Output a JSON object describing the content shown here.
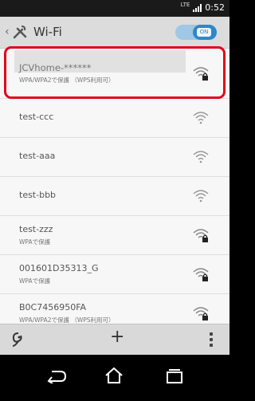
{
  "status": {
    "network": "LTE",
    "time": "0:52"
  },
  "header": {
    "title": "Wi-Fi",
    "toggle_label": "ON"
  },
  "networks": [
    {
      "ssid": "JCVhome-******",
      "subtitle": "WPA/WPA2で保護 （WPS利用可）",
      "secured": true,
      "selected": true
    },
    {
      "ssid": "test-ccc",
      "subtitle": "",
      "secured": false
    },
    {
      "ssid": "test-aaa",
      "subtitle": "",
      "secured": false
    },
    {
      "ssid": "test-bbb",
      "subtitle": "",
      "secured": false
    },
    {
      "ssid": "test-zzz",
      "subtitle": "WPAで保護",
      "secured": true
    },
    {
      "ssid": "001601D35313_G",
      "subtitle": "WPAで保護",
      "secured": true
    },
    {
      "ssid": "B0C7456950FA",
      "subtitle": "WPA/WPA2で保護 （WPS利用可）",
      "secured": true
    }
  ],
  "bottom_bar": {
    "add_label": "+"
  },
  "colors": {
    "highlight": "#e0061b",
    "toggle_on": "#2e87c8"
  }
}
